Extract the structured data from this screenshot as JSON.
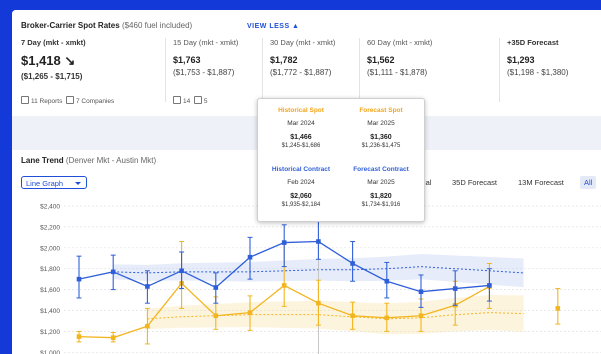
{
  "spot_rates": {
    "title": "Broker-Carrier Spot Rates",
    "subtitle": "($460 fuel included)",
    "view_less": "VIEW LESS ▲",
    "columns": [
      {
        "label": "7 Day (mkt - xmkt)",
        "value": "$1,418 ↘",
        "range": "($1,265 - $1,715)"
      },
      {
        "label": "15 Day (mkt - xmkt)",
        "value": "$1,763",
        "range": "($1,753 - $1,887)"
      },
      {
        "label": "30 Day (mkt - xmkt)",
        "value": "$1,782",
        "range": "($1,772 - $1,887)"
      },
      {
        "label": "60 Day (mkt - xmkt)",
        "value": "$1,562",
        "range": "($1,111 - $1,878)"
      },
      {
        "label": "+35D Forecast",
        "value": "$1,293",
        "range": "($1,198 - $1,380)"
      }
    ],
    "meta": {
      "reports": "11 Reports",
      "companies": "7 Companies",
      "col2_reports": "14",
      "col2_companies": "5"
    }
  },
  "lane_trend": {
    "title": "Lane Trend",
    "subtitle": "(Denver Mkt - Austin Mkt)",
    "graph_select": "Line Graph",
    "tabs": [
      "istorical",
      "35D Forecast",
      "13M Forecast",
      "All"
    ],
    "active_tab": "All"
  },
  "tooltip": {
    "historical_spot": {
      "label": "Historical Spot",
      "date": "Mar 2024",
      "value": "$1,466",
      "range": "$1,245-$1,686"
    },
    "forecast_spot": {
      "label": "Forecast Spot",
      "date": "Mar 2025",
      "value": "$1,360",
      "range": "$1,236-$1,475"
    },
    "historical_contract": {
      "label": "Historical Contract",
      "date": "Feb 2024",
      "value": "$2,060",
      "range": "$1,935-$2,184"
    },
    "forecast_contract": {
      "label": "Forecast Contract",
      "date": "Mar 2025",
      "value": "$1,820",
      "range": "$1,734-$1,916"
    }
  },
  "colors": {
    "spot": "#f2b51f",
    "contract": "#2f5fd8",
    "accent": "#1f4fd6",
    "background": "#1339d8"
  },
  "chart_data": {
    "type": "line",
    "y_ticks": [
      "$2,400",
      "$2,200",
      "$2,000",
      "$1,800",
      "$1,600",
      "$1,400",
      "$1,200",
      "$1,000"
    ],
    "ylim": [
      1000,
      2450
    ],
    "points": 15,
    "series": [
      {
        "name": "Historical Contract",
        "values": [
          1700,
          1770,
          1630,
          1780,
          1620,
          1910,
          2050,
          2060,
          1850,
          1680,
          1580,
          1610,
          1640,
          null,
          null
        ],
        "low": [
          1520,
          1600,
          1470,
          1610,
          1470,
          1700,
          1820,
          1890,
          1680,
          1520,
          1430,
          1450,
          1490,
          null,
          null
        ],
        "high": [
          1920,
          1930,
          1780,
          1960,
          1760,
          2100,
          2220,
          2260,
          2060,
          1860,
          1740,
          1780,
          1800,
          null,
          null
        ]
      },
      {
        "name": "Historical Spot",
        "values": [
          1150,
          1140,
          1250,
          1660,
          1350,
          1380,
          1640,
          1470,
          1350,
          1330,
          1350,
          1450,
          1630,
          null,
          1420
        ],
        "low": [
          1100,
          1100,
          1080,
          1420,
          1220,
          1210,
          1440,
          1260,
          1220,
          1200,
          1200,
          1260,
          1420,
          null,
          1270
        ],
        "high": [
          1200,
          1190,
          1420,
          2060,
          1530,
          1540,
          2040,
          1690,
          1480,
          1470,
          1510,
          1680,
          1850,
          null,
          1610
        ]
      },
      {
        "name": "Forecast Contract",
        "values": [
          null,
          1770,
          1760,
          1770,
          1770,
          1770,
          1780,
          1790,
          1790,
          1800,
          1820,
          1800,
          1780,
          1760,
          null
        ]
      },
      {
        "name": "Forecast Spot",
        "values": [
          null,
          null,
          1320,
          1340,
          1350,
          1360,
          1360,
          1360,
          1340,
          1320,
          1330,
          1360,
          1380,
          1370,
          null
        ]
      }
    ]
  }
}
